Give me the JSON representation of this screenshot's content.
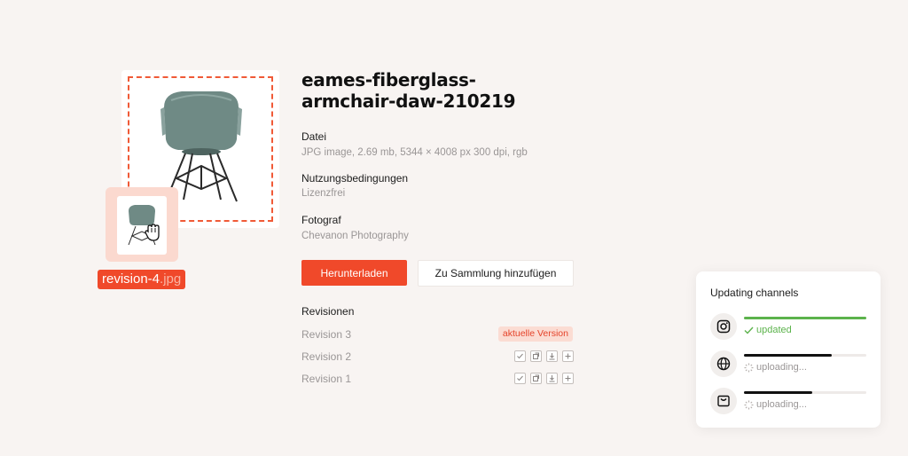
{
  "asset": {
    "title_line1": "eames-fiberglass-",
    "title_line2": "armchair-daw-210219",
    "drag_filename": "revision-4",
    "drag_extension": ".jpg",
    "file_label": "Datei",
    "file_value": "JPG image, 2.69 mb, 5344 × 4008 px 300 dpi, rgb",
    "license_label": "Nutzungsbedingungen",
    "license_value": "Lizenzfrei",
    "photographer_label": "Fotograf",
    "photographer_value": "Chevanon Photography"
  },
  "actions": {
    "download": "Herunterladen",
    "add_to_collection": "Zu Sammlung hinzufügen"
  },
  "revisions": {
    "heading": "Revisionen",
    "items": [
      {
        "name": "Revision 3",
        "badge": "aktuelle Version"
      },
      {
        "name": "Revision 2",
        "icons": [
          "check-icon",
          "replace-icon",
          "download-icon",
          "add-icon"
        ]
      },
      {
        "name": "Revision 1",
        "icons": [
          "check-icon",
          "replace-icon",
          "download-icon",
          "add-icon"
        ]
      }
    ]
  },
  "channels_panel": {
    "title": "Updating channels",
    "channels": [
      {
        "icon": "instagram-icon",
        "progress": 1.0,
        "status": "updated",
        "color": "#5cb34c"
      },
      {
        "icon": "globe-icon",
        "progress": 0.72,
        "status": "uploading..."
      },
      {
        "icon": "shop-icon",
        "progress": 0.56,
        "status": "uploading..."
      }
    ]
  },
  "colors": {
    "accent": "#f0492a",
    "success": "#5cb34c",
    "background": "#f8f4f2"
  }
}
